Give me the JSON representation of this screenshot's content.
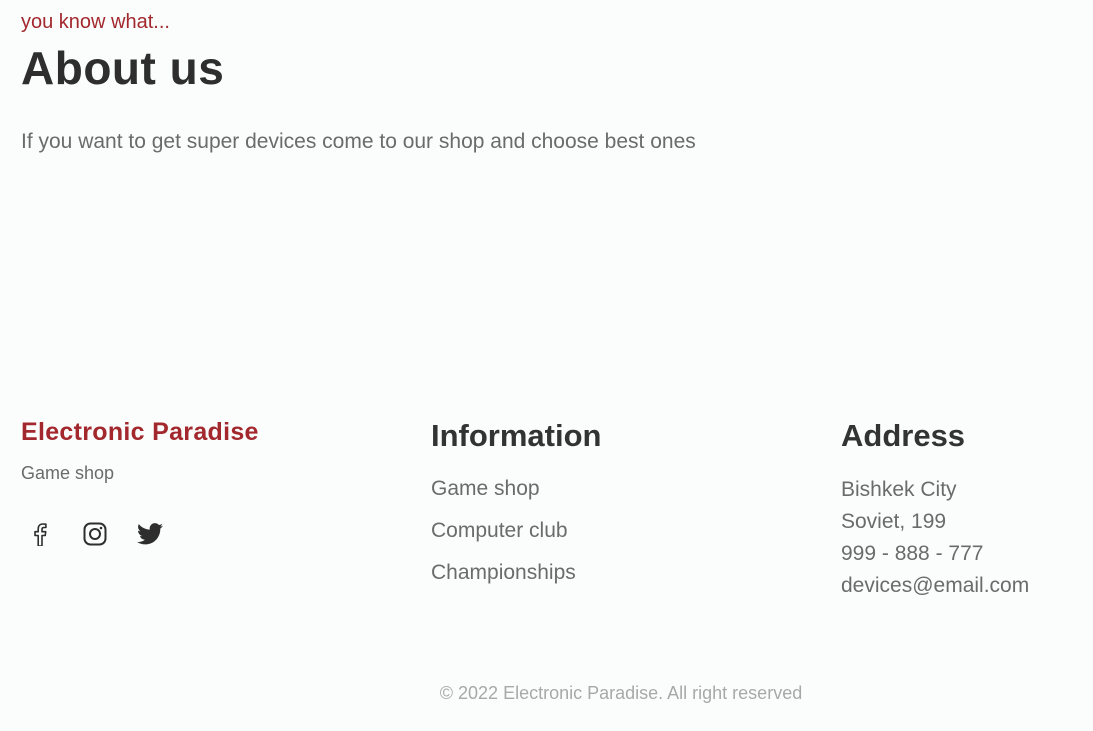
{
  "about": {
    "eyebrow": "you know what...",
    "title": "About us",
    "text": "If you want to get super devices come to our shop and choose best ones"
  },
  "footer": {
    "brand": {
      "name": "Electronic Paradise",
      "subtitle": "Game shop",
      "socials": [
        {
          "icon": "facebook-icon"
        },
        {
          "icon": "instagram-icon"
        },
        {
          "icon": "twitter-icon"
        }
      ]
    },
    "information": {
      "title": "Information",
      "items": [
        "Game shop",
        "Computer club",
        "Championships"
      ]
    },
    "address": {
      "title": "Address",
      "lines": [
        "Bishkek City",
        "Soviet, 199",
        "999 - 888 - 777",
        "devices@email.com"
      ]
    },
    "copyright": "© 2022 Electronic Paradise. All right reserved"
  },
  "colors": {
    "accent": "#a3282d",
    "heading": "#2e2e2e",
    "body_text": "#6b6b6b",
    "muted": "#a8a8a8",
    "background": "#fbfdfd"
  }
}
